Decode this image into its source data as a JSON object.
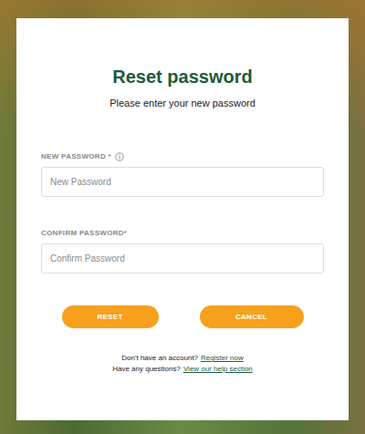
{
  "page": {
    "title": "Reset password",
    "subtitle": "Please enter your new password"
  },
  "fields": [
    {
      "label": "NEW PASSWORD *",
      "placeholder": "New Password",
      "info": true
    },
    {
      "label": "CONFIRM PASSWORD*",
      "placeholder": "Confirm Password",
      "info": false
    }
  ],
  "buttons": [
    "RESET",
    "CANCEL"
  ],
  "footer": [
    {
      "text": "Don't have an account?",
      "link": "Register now"
    },
    {
      "text": "Have any questions?",
      "link": "View our help section"
    }
  ]
}
